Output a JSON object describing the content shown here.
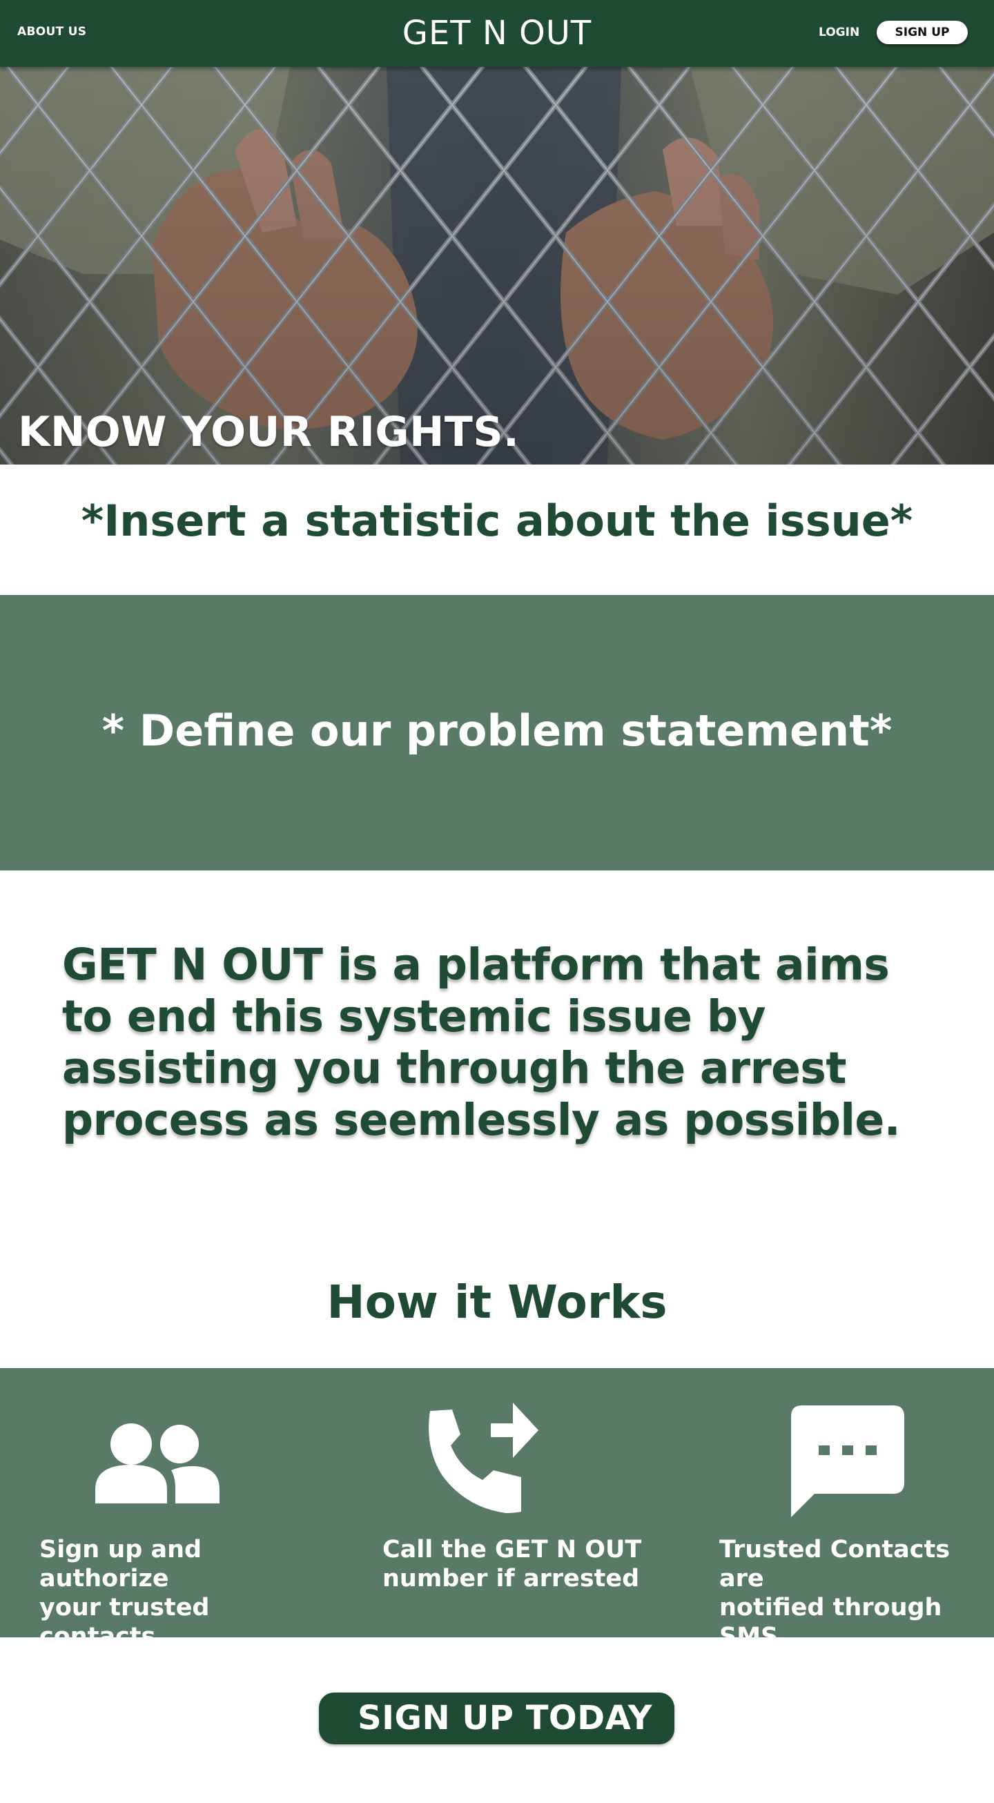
{
  "header": {
    "about": "ABOUT US",
    "brand": "GET N OUT",
    "login": "LOGIN",
    "signup": "SIGN UP"
  },
  "hero": {
    "title": "KNOW YOUR RIGHTS."
  },
  "statistic": "*Insert a statistic about the issue*",
  "problem": "* Define our problem statement*",
  "mission": "GET N OUT is a platform that aims to end this systemic issue by assisting you through the arrest process as seemlessly as possible.",
  "how_it_works": {
    "title": "How it Works",
    "steps": [
      {
        "icon": "people-icon",
        "text": "Sign up and authorize\nyour trusted contacts"
      },
      {
        "icon": "phone-forward-icon",
        "text": "Call the GET N OUT\nnumber if arrested"
      },
      {
        "icon": "sms-icon",
        "text": "Trusted Contacts are\nnotified through SMS"
      }
    ]
  },
  "cta": "SIGN UP TODAY",
  "colors": {
    "primary": "#1f4a33",
    "band": "#587a67",
    "text_light": "#ffffff"
  }
}
